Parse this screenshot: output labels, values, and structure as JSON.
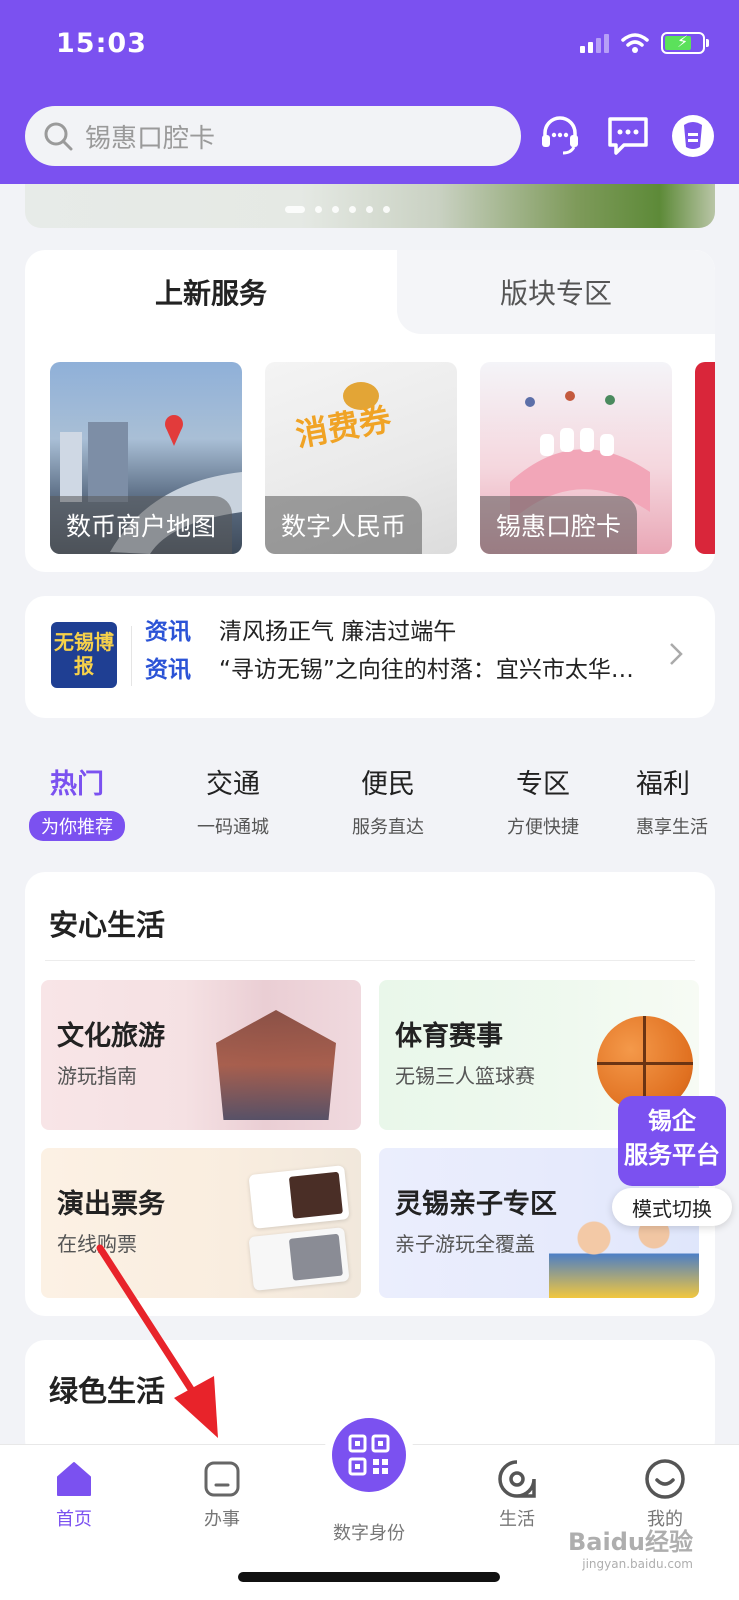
{
  "status_bar": {
    "time": "15:03"
  },
  "search": {
    "placeholder": "锡惠口腔卡"
  },
  "header_icons": [
    "headset-icon",
    "message-icon",
    "profile-icon"
  ],
  "services": {
    "tabs": [
      {
        "label": "上新服务",
        "active": true
      },
      {
        "label": "版块专区",
        "active": false
      }
    ],
    "items": [
      {
        "label": "数币商户地图"
      },
      {
        "label": "数字人民币",
        "image_text": "消费券"
      },
      {
        "label": "锡惠口腔卡"
      }
    ]
  },
  "news": {
    "logo_text": "无锡博报",
    "items": [
      {
        "tag": "资讯",
        "text": "清风扬正气  廉洁过端午"
      },
      {
        "tag": "资讯",
        "text": "“寻访无锡”之向往的村落：宜兴市太华…"
      }
    ]
  },
  "categories": [
    {
      "title": "热门",
      "sub": "为你推荐",
      "active": true
    },
    {
      "title": "交通",
      "sub": "一码通城"
    },
    {
      "title": "便民",
      "sub": "服务直达"
    },
    {
      "title": "专区",
      "sub": "方便快捷"
    },
    {
      "title": "福利",
      "sub": "惠享生活"
    }
  ],
  "life": {
    "title": "安心生活",
    "tiles": [
      {
        "title": "文化旅游",
        "sub": "游玩指南"
      },
      {
        "title": "体育赛事",
        "sub": "无锡三人篮球赛"
      },
      {
        "title": "演出票务",
        "sub": "在线购票"
      },
      {
        "title": "灵锡亲子专区",
        "sub": "亲子游玩全覆盖"
      }
    ]
  },
  "float_badge": {
    "line1": "锡企",
    "line2": "服务平台",
    "switch": "模式切换"
  },
  "green": {
    "title": "绿色生活"
  },
  "bottom_nav": [
    {
      "label": "首页",
      "icon": "home-icon",
      "active": true
    },
    {
      "label": "办事",
      "icon": "tasks-icon"
    },
    {
      "label": "数字身份",
      "icon": "qr-code-icon"
    },
    {
      "label": "生活",
      "icon": "life-icon"
    },
    {
      "label": "我的",
      "icon": "smile-icon"
    }
  ],
  "watermark": {
    "text": "Baidu经验",
    "sub": "jingyan.baidu.com"
  },
  "colors": {
    "brand": "#7b51f0",
    "news_tag": "#2b53d6",
    "annotation_arrow": "#e8232a"
  }
}
